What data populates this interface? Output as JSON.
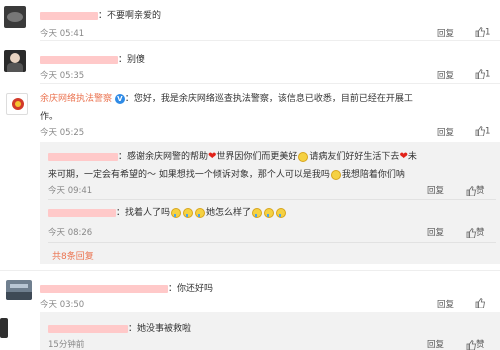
{
  "comments": [
    {
      "text": "：不要啊亲爱的",
      "time": "今天 05:41",
      "reply": "回复",
      "like": "1"
    },
    {
      "text": "：别傻",
      "time": "今天 05:35",
      "reply": "回复",
      "like": "1"
    },
    {
      "name": "余庆网络执法警察",
      "text": "：您好，我是余庆网络巡查执法警察，该信息已收悉，目前已经在开展工",
      "text2": "作。",
      "time": "今天 05:25",
      "reply": "回复",
      "like": "1"
    },
    {
      "text": "：你还好吗",
      "time": "今天 03:50",
      "reply": "回复",
      "like": ""
    }
  ],
  "replies": [
    {
      "text_a": "：感谢余庆网警的帮助",
      "text_b": "世界因你们而更美好",
      "text_c": "请病友们好好生活下去",
      "text_d": "未",
      "text2_a": "来可期，一定会有希望的～ 如果想找一个倾诉对象，那个人可以是我吗",
      "text2_b": "我想陪着你们呐",
      "time": "今天 09:41",
      "reply": "回复",
      "like": "赞"
    },
    {
      "text_a": "：找着人了吗",
      "text_b": "她怎么样了",
      "time": "今天 08:26",
      "reply": "回复",
      "like": "赞"
    },
    {
      "text": "：她没事被救啦",
      "time": "15分钟前",
      "reply": "回复",
      "like": "赞"
    }
  ],
  "more_replies": "共8条回复",
  "colors": {
    "link": "#eb7350",
    "verified": "#2f8be6"
  }
}
